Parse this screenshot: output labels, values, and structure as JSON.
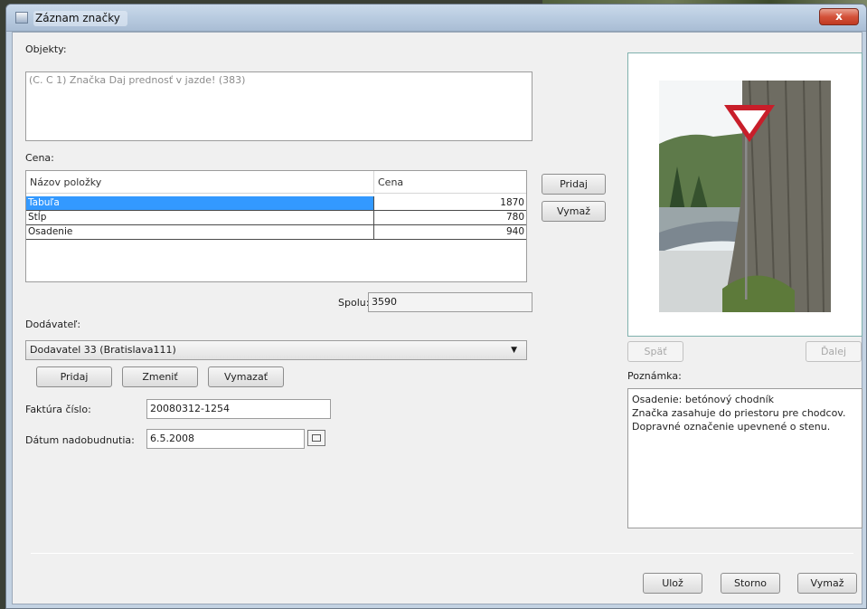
{
  "window": {
    "title": "Záznam značky",
    "close_symbol": "x"
  },
  "objekty": {
    "label": "Objekty:",
    "value": "(C. C 1) Značka Daj prednosť v jazde! (383)"
  },
  "cena": {
    "label": "Cena:",
    "columns": [
      "Názov položky",
      "Cena"
    ],
    "rows": [
      {
        "name": "Tabuľa",
        "price": "1870",
        "selected": true
      },
      {
        "name": "Stĺp",
        "price": "780",
        "selected": false
      },
      {
        "name": "Osadenie",
        "price": "940",
        "selected": false
      }
    ],
    "add_label": "Pridaj",
    "remove_label": "Vymaž",
    "total_label": "Spolu:",
    "total_value": "3590"
  },
  "dodavatel": {
    "label": "Dodávateľ:",
    "selected": "Dodavatel 33 (Bratislava111)",
    "add_label": "Pridaj",
    "change_label": "Zmeniť",
    "delete_label": "Vymazať"
  },
  "faktura": {
    "label": "Faktúra číslo:",
    "value": "20080312-1254"
  },
  "datum": {
    "label": "Dátum nadobudnutia:",
    "value": "6.5.2008"
  },
  "image_nav": {
    "back_label": "Späť",
    "next_label": "Ďalej"
  },
  "poznamka": {
    "label": "Poznámka:",
    "lines": [
      "Osadenie: betónový chodník",
      "Značka zasahuje do priestoru pre chodcov.",
      "Dopravné označenie upevnené o stenu."
    ]
  },
  "footer": {
    "save_label": "Ulož",
    "cancel_label": "Storno",
    "delete_label": "Vymaž"
  },
  "colors": {
    "selection": "#3399ff",
    "close_button": "#d4523a",
    "image_frame": "#7fb1ad"
  },
  "icons": [
    "app-icon",
    "close-icon",
    "chevron-down-icon",
    "calendar-icon"
  ]
}
